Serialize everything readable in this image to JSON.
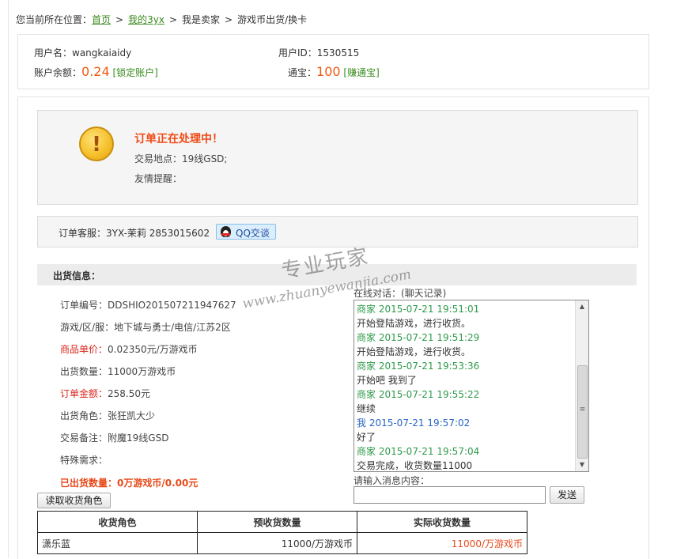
{
  "breadcrumb": {
    "prefix": "您当前所在位置：",
    "items": [
      "首页",
      "我的3yx",
      "我是卖家",
      "游戏币出货/换卡"
    ],
    "sep": ">"
  },
  "user": {
    "username_label": "用户名：",
    "username": "wangkaiaidy",
    "userid_label": "用户ID：",
    "userid": "1530515",
    "balance_label": "账户余额：",
    "balance": "0.24",
    "lock_link": "[锁定账户]",
    "tongbao_label": "通宝：",
    "tongbao": "100",
    "earn_link": "[赚通宝]"
  },
  "status": {
    "icon": "warning-icon",
    "title": "订单正在处理中！",
    "location": "交易地点：19线GSD;",
    "tips": "友情提醒："
  },
  "service": {
    "label": "订单客服：3YX-茉莉  2853015602",
    "qq_button": "QQ交谈"
  },
  "info": {
    "title": "出货信息：",
    "fields": [
      {
        "k": "订单编号：",
        "v": "DDSHIO201507211947627",
        "red": false
      },
      {
        "k": "游戏/区/服：",
        "v": "地下城与勇士/电信/江苏2区",
        "red": false
      },
      {
        "k": "商品单价：",
        "v": "0.02350元/万游戏币",
        "red": true
      },
      {
        "k": "出货数量：",
        "v": "11000万游戏币",
        "red": false
      },
      {
        "k": "订单金额：",
        "v": "258.50元",
        "red": true
      },
      {
        "k": "出货角色：",
        "v": "张狂凯大少",
        "red": false
      },
      {
        "k": "交易备注：",
        "v": "附魔19线GSD",
        "red": false
      },
      {
        "k": "特殊需求：",
        "v": "",
        "red": false
      }
    ],
    "shipped": "已出货数量：0万游戏币/0.00元",
    "read_button": "读取收货角色"
  },
  "chat": {
    "label": "在线对话：(聊天记录)",
    "messages": [
      {
        "type": "merchant",
        "text": "商家 2015-07-21 19:51:01"
      },
      {
        "type": "body",
        "text": "开始登陆游戏，进行收货。"
      },
      {
        "type": "merchant",
        "text": "商家 2015-07-21 19:51:29"
      },
      {
        "type": "body",
        "text": "开始登陆游戏，进行收货。"
      },
      {
        "type": "merchant",
        "text": "商家 2015-07-21 19:53:36"
      },
      {
        "type": "body",
        "text": "开始吧 我到了"
      },
      {
        "type": "merchant",
        "text": "商家 2015-07-21 19:55:22"
      },
      {
        "type": "body",
        "text": "继续"
      },
      {
        "type": "me",
        "text": "我 2015-07-21 19:57:02"
      },
      {
        "type": "body",
        "text": "好了"
      },
      {
        "type": "merchant",
        "text": "商家 2015-07-21 19:57:04"
      },
      {
        "type": "body",
        "text": "交易完成，收货数量11000"
      }
    ],
    "input_label": "请输入消息内容：",
    "input_value": "",
    "send_button": "发送"
  },
  "table": {
    "headers": [
      "收货角色",
      "预收货数量",
      "实际收货数量"
    ],
    "rows": [
      {
        "name": "潇乐蓝",
        "pre": "11000/万游戏币",
        "act": "11000/万游戏币"
      }
    ]
  },
  "watermark": {
    "line1": "专业玩家",
    "line2": "www.zhuanyewanjia.com"
  }
}
